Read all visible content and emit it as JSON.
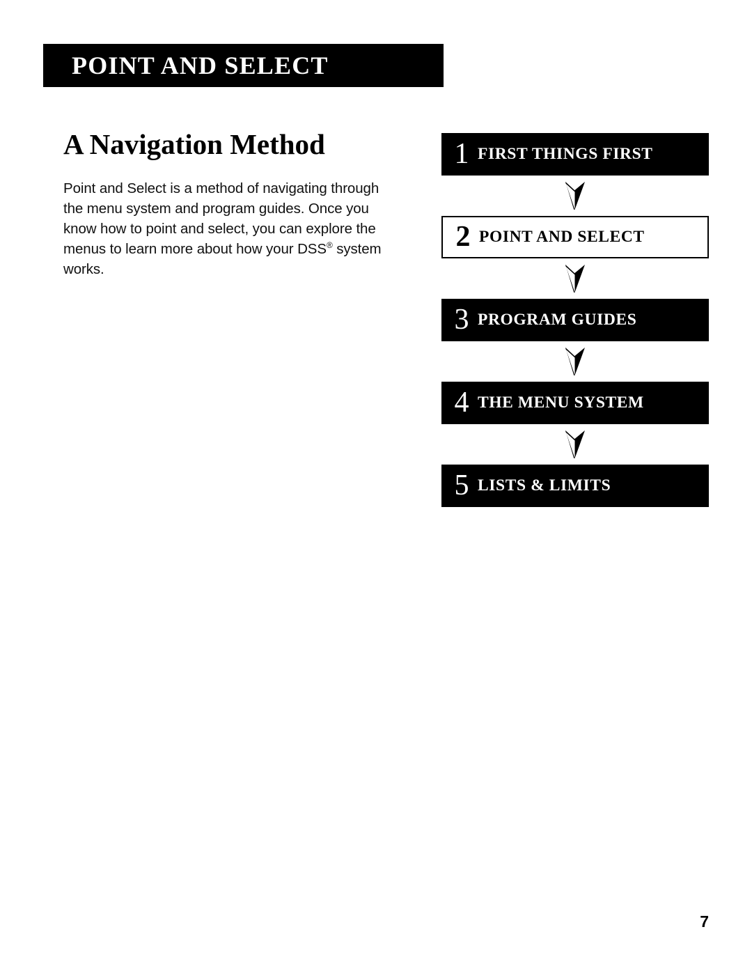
{
  "header": {
    "banner_title": "POINT AND SELECT"
  },
  "content": {
    "section_title": "A Navigation Method",
    "paragraph_part1": "Point and Select is a method of navigating through the menu system and program guides. Once you know how to point and select, you can explore the menus to learn more about how your DSS",
    "paragraph_trademark": "®",
    "paragraph_part2": " system works."
  },
  "flow": {
    "steps": [
      {
        "number": "1",
        "label": "FIRST THINGS FIRST",
        "style": "solid"
      },
      {
        "number": "2",
        "label": "POINT AND SELECT",
        "style": "inverted"
      },
      {
        "number": "3",
        "label": "PROGRAM GUIDES",
        "style": "solid"
      },
      {
        "number": "4",
        "label": "THE MENU SYSTEM",
        "style": "solid"
      },
      {
        "number": "5",
        "label": "LISTS & LIMITS",
        "style": "solid"
      }
    ],
    "arrow_icon": "down-arrow-icon"
  },
  "footer": {
    "page_number": "7"
  },
  "colors": {
    "ink": "#000000",
    "paper": "#ffffff",
    "reverse_text": "#ffffff"
  }
}
